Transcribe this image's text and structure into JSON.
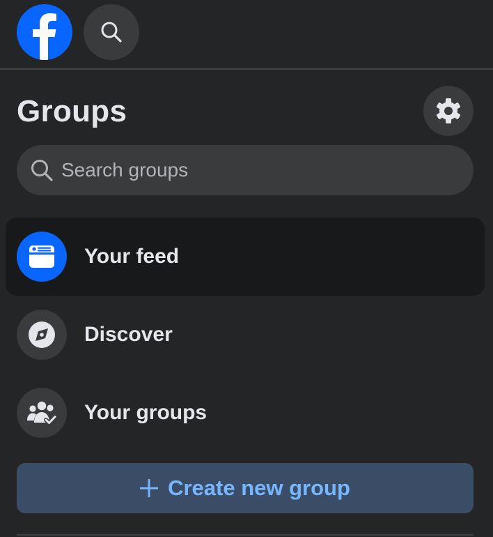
{
  "header": {
    "logo_icon": "facebook-logo-icon",
    "search_icon": "search-icon"
  },
  "page": {
    "title": "Groups",
    "settings_icon": "gear-icon"
  },
  "search": {
    "placeholder": "Search groups",
    "value": ""
  },
  "nav": {
    "items": [
      {
        "label": "Your feed",
        "icon": "feed-icon",
        "active": true
      },
      {
        "label": "Discover",
        "icon": "compass-icon",
        "active": false
      },
      {
        "label": "Your groups",
        "icon": "groups-icon",
        "active": false
      }
    ]
  },
  "create": {
    "label": "Create new group",
    "icon": "plus-icon"
  },
  "colors": {
    "background": "#242526",
    "brand": "#0866ff",
    "active_item_bg": "#18191a",
    "create_btn_bg": "#3b4d66",
    "create_btn_text": "#75b6ff"
  }
}
